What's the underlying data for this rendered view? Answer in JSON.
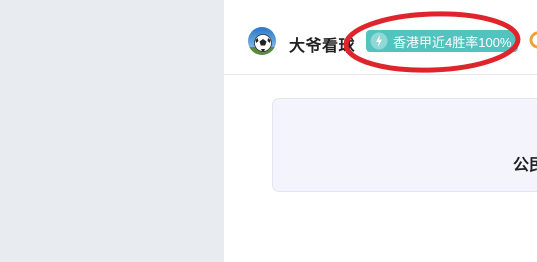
{
  "user": {
    "name": "大爷看球",
    "avatar_icon": "soccer-ball-icon"
  },
  "badge": {
    "text": "香港甲近4胜率100%",
    "icon": "lightning-icon",
    "color": "#53c3c0"
  },
  "annotation": {
    "color": "#e0242c"
  },
  "card": {
    "title": "公民"
  }
}
